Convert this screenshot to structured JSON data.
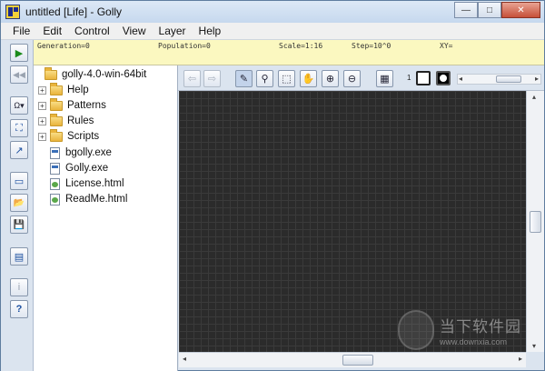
{
  "window": {
    "title": "untitled [Life] - Golly",
    "controls": {
      "minimize": "—",
      "maximize": "□",
      "close": "✕"
    }
  },
  "menu": [
    "File",
    "Edit",
    "Control",
    "View",
    "Layer",
    "Help"
  ],
  "status": {
    "generation": "Generation=0",
    "population": "Population=0",
    "scale": "Scale=1:16",
    "step": "Step=10^0",
    "xy": "XY="
  },
  "left_toolbar": [
    {
      "name": "start-generating-icon",
      "glyph": "▶"
    },
    {
      "name": "reset-icon",
      "glyph": "◀◀"
    },
    {
      "name": "algorithm-icon",
      "glyph": "Ω▾"
    },
    {
      "name": "fit-pattern-icon",
      "glyph": "⛶"
    },
    {
      "name": "scale-icon",
      "glyph": "↗"
    },
    {
      "name": "new-pattern-icon",
      "glyph": "▭"
    },
    {
      "name": "open-pattern-icon",
      "glyph": "📂"
    },
    {
      "name": "save-pattern-icon",
      "glyph": "💾"
    },
    {
      "name": "patterns-panel-icon",
      "glyph": "▤"
    },
    {
      "name": "info-icon",
      "glyph": "i"
    },
    {
      "name": "help-icon",
      "glyph": "?"
    }
  ],
  "tree": {
    "root": "golly-4.0-win-64bit",
    "folders": [
      "Help",
      "Patterns",
      "Rules",
      "Scripts"
    ],
    "files": [
      "bgolly.exe",
      "Golly.exe",
      "License.html",
      "ReadMe.html"
    ]
  },
  "edit_toolbar": {
    "buttons": [
      {
        "name": "back-icon",
        "glyph": "⇦"
      },
      {
        "name": "forward-icon",
        "glyph": "⇨"
      },
      {
        "name": "draw-icon",
        "glyph": "✎"
      },
      {
        "name": "pick-icon",
        "glyph": "⚲"
      },
      {
        "name": "select-icon",
        "glyph": "⬚"
      },
      {
        "name": "move-hand-icon",
        "glyph": "✋"
      },
      {
        "name": "zoom-in-icon",
        "glyph": "⊕"
      },
      {
        "name": "zoom-out-icon",
        "glyph": "⊖"
      },
      {
        "name": "all-states-icon",
        "glyph": "▦"
      }
    ],
    "state_number": "1"
  },
  "watermark": {
    "cn": "当下软件园",
    "url": "www.downxia.com"
  }
}
